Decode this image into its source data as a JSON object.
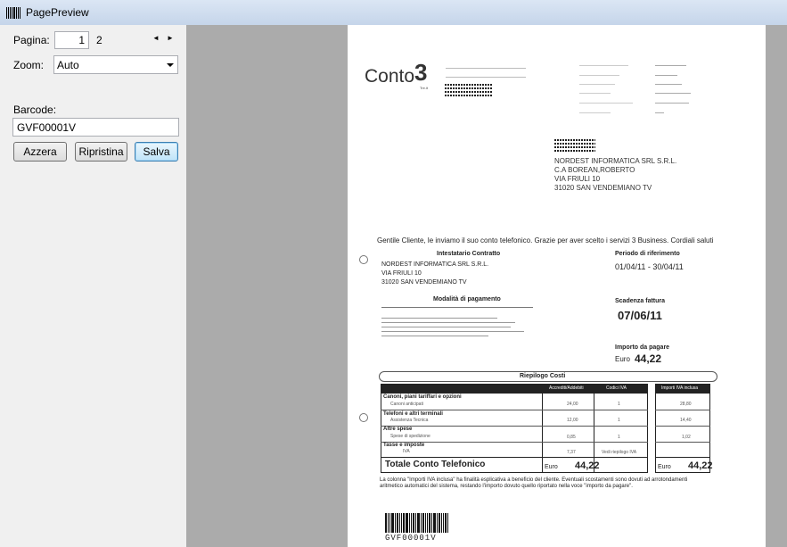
{
  "window": {
    "title": "PagePreview"
  },
  "nav": {
    "page_label": "Pagina:",
    "page_value": "1",
    "page_total": "2",
    "prev_glyph": "◄",
    "next_glyph": "►"
  },
  "zoom": {
    "label": "Zoom:",
    "value": "Auto"
  },
  "barcode": {
    "label": "Barcode:",
    "value": "GVF00001V"
  },
  "buttons": {
    "reset": "Azzera",
    "restore": "Ripristina",
    "save": "Salva"
  },
  "doc": {
    "brand": "Conto",
    "brand_sub": "Tre.it",
    "recipient": [
      "NORDEST INFORMATICA SRL S.R.L.",
      "C.A BOREAN,ROBERTO",
      "VIA FRIULI 10",
      "31020 SAN VENDEMIANO TV"
    ],
    "greeting": "Gentile Cliente, le inviamo il suo conto telefonico. Grazie per aver scelto i servizi 3 Business. Cordiali saluti",
    "holder_title": "Intestatario Contratto",
    "holder": [
      "NORDEST INFORMATICA SRL S.R.L.",
      "VIA FRIULI 10",
      "31020  SAN VENDEMIANO  TV"
    ],
    "period_title": "Periodo di riferimento",
    "period_value": "01/04/11 - 30/04/11",
    "payment_title": "Modalità di pagamento",
    "due_title": "Scadenza fattura",
    "due_value": "07/06/11",
    "amount_title": "Importo da pagare",
    "amount_currency": "Euro",
    "amount_value": "44,22",
    "summary_title": "Riepilogo Costi",
    "col_credit": "Accrediti/Addebiti",
    "col_vat": "Codici IVA",
    "col_incl": "Importi IVA inclusa",
    "rows": [
      {
        "title": "Canoni, piani tariffari e opzioni",
        "detail": "Canoni anticipati",
        "credit": "24,00",
        "vat": "1",
        "incl": "28,80"
      },
      {
        "title": "Telefoni e altri terminali",
        "detail": "Assistenza Tecnica",
        "credit": "12,00",
        "vat": "1",
        "incl": "14,40"
      },
      {
        "title": "Altre spese",
        "detail": "Spese di spedizione",
        "credit": "0,85",
        "vat": "1",
        "incl": "1,02"
      },
      {
        "title": "Tasse e imposte",
        "detail": "IVA",
        "credit": "7,37",
        "vat": "Vedi riepilogo IVA",
        "incl": ""
      }
    ],
    "total_label": "Totale Conto Telefonico",
    "total_currency": "Euro",
    "total_value": "44,22",
    "note1": "La colonna \"Importi IVA inclusa\" ha finalità esplicativa a beneficio del cliente. Eventuali scostamenti sono dovuti ad arrotondamenti",
    "note2": "aritmetico automatici del sistema, restando l'importo dovuto quello riportato nella voce \"importo da pagare\".",
    "barcode_text": "GVF00001V"
  }
}
